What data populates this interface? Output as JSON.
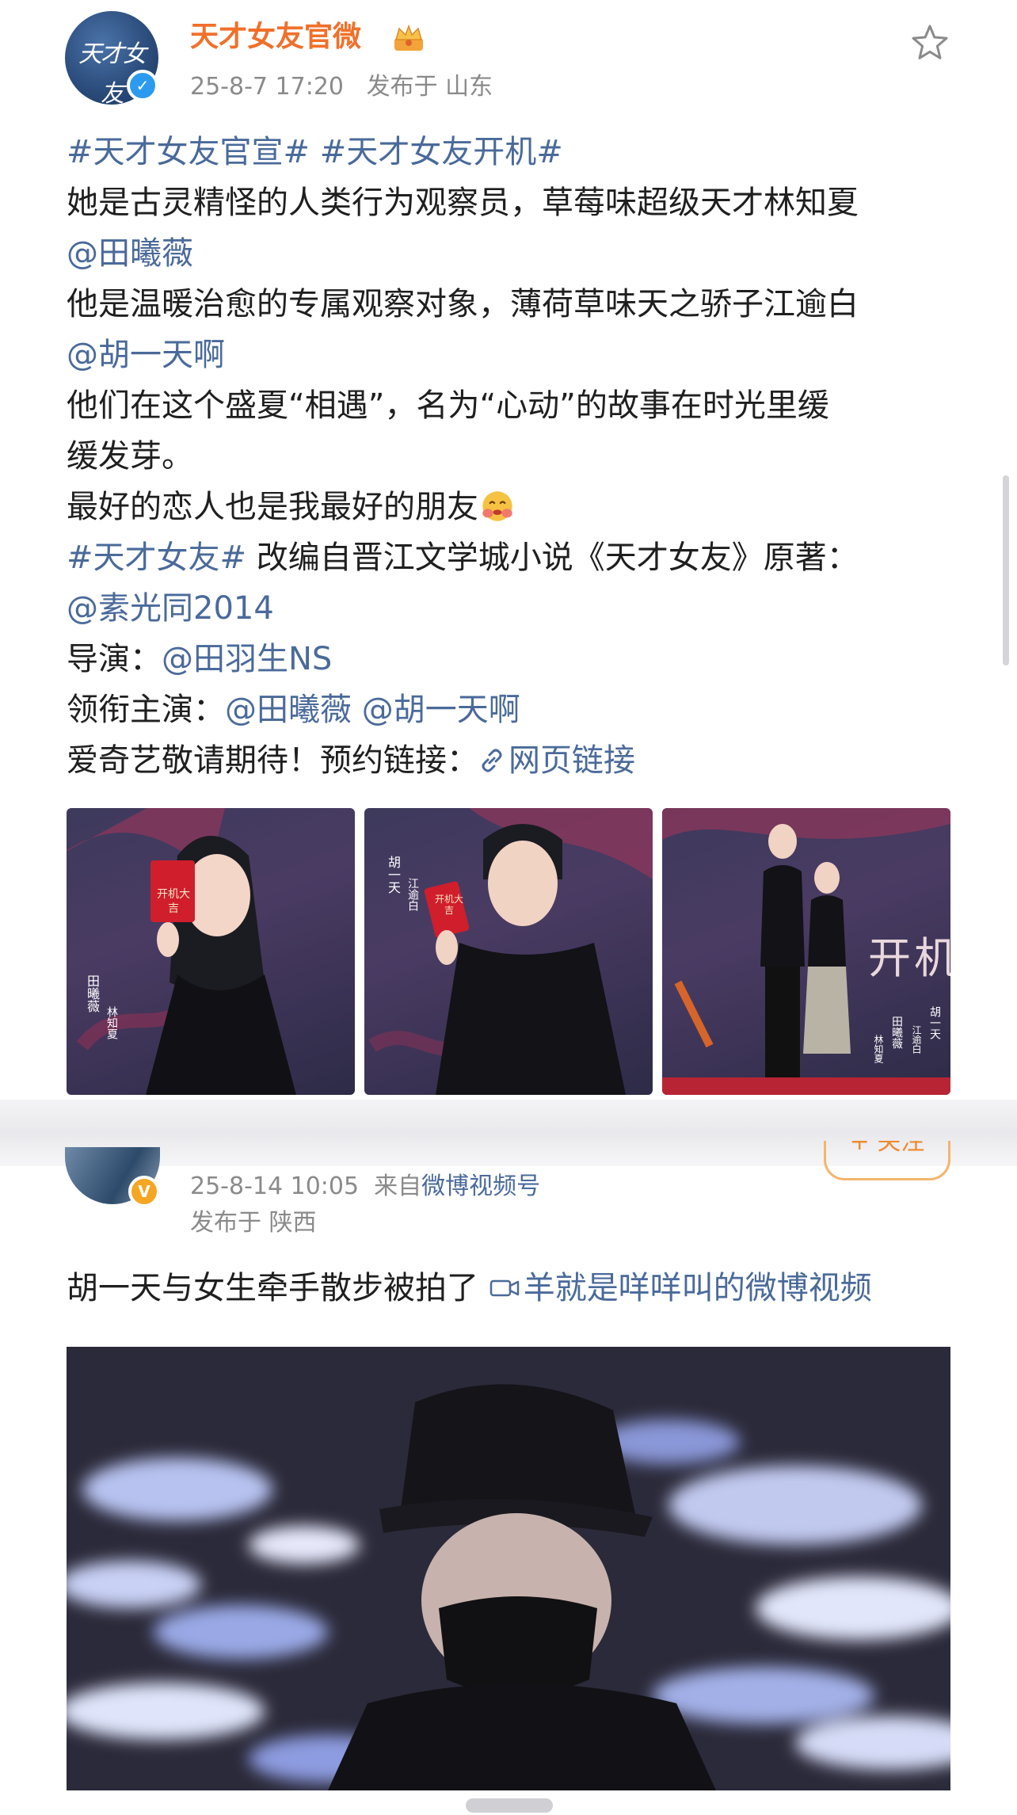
{
  "post1": {
    "avatar_logo_text": "天才女友",
    "username": "天才女友官微",
    "timestamp": "25-8-7 17:20",
    "location": "发布于 山东",
    "lines": [
      [
        {
          "t": "#天才女友官宣# #天才女友开机#",
          "link": true
        }
      ],
      [
        {
          "t": "她是古灵精怪的人类行为观察员，草莓味超级天才林知夏",
          "link": false
        }
      ],
      [
        {
          "t": "@田曦薇",
          "link": true
        }
      ],
      [
        {
          "t": "他是温暖治愈的专属观察对象，薄荷草味天之骄子江逾白",
          "link": false
        }
      ],
      [
        {
          "t": "@胡一天啊",
          "link": true
        }
      ],
      [
        {
          "t": "他们在这个盛夏“相遇”，名为“心动”的故事在时光里缓",
          "link": false
        }
      ],
      [
        {
          "t": "缓发芽。",
          "link": false
        }
      ],
      [
        {
          "t": "最好的恋人也是我最好的朋友",
          "link": false
        },
        {
          "emoji": "hug-emoji"
        }
      ],
      [
        {
          "t": "#天才女友#",
          "link": true
        },
        {
          "t": " 改编自晋江文学城小说《天才女友》原著：",
          "link": false
        }
      ],
      [
        {
          "t": "@素光同2014",
          "link": true
        }
      ],
      [
        {
          "t": "导演：",
          "link": false
        },
        {
          "t": "@田羽生NS",
          "link": true
        }
      ],
      [
        {
          "t": "领衔主演：",
          "link": false
        },
        {
          "t": "@田曦薇 @胡一天啊",
          "link": true
        }
      ],
      [
        {
          "t": "爱奇艺敬请期待！预约链接：",
          "link": false
        },
        {
          "icon": "link-icon"
        },
        {
          "t": "网页链接",
          "link": true
        }
      ]
    ],
    "photos": [
      {
        "card_title": "开机大吉",
        "side_name": "田曦薇",
        "role": "林知夏"
      },
      {
        "card_title": "开机大吉",
        "side_name": "胡一天",
        "role": "江逾白"
      },
      {
        "poster_text": "开机大吉",
        "side_names": [
          "胡一天",
          "田曦薇"
        ],
        "roles": [
          "江逾白",
          "林知夏"
        ]
      }
    ]
  },
  "post2": {
    "follow_label": "+ 关注",
    "timestamp": "25-8-14 10:05",
    "source_prefix": "来自",
    "source": "微博视频号",
    "location": "发布于 陕西",
    "text": "胡一天与女生牵手散步被拍了",
    "video_link": "羊就是咩咩叫的微博视频"
  },
  "colors": {
    "username": "#f0702a",
    "link": "#4a6a9a",
    "meta": "#8a8a8a",
    "verified_blue": "#2c9bef",
    "verified_orange": "#f5a623"
  }
}
